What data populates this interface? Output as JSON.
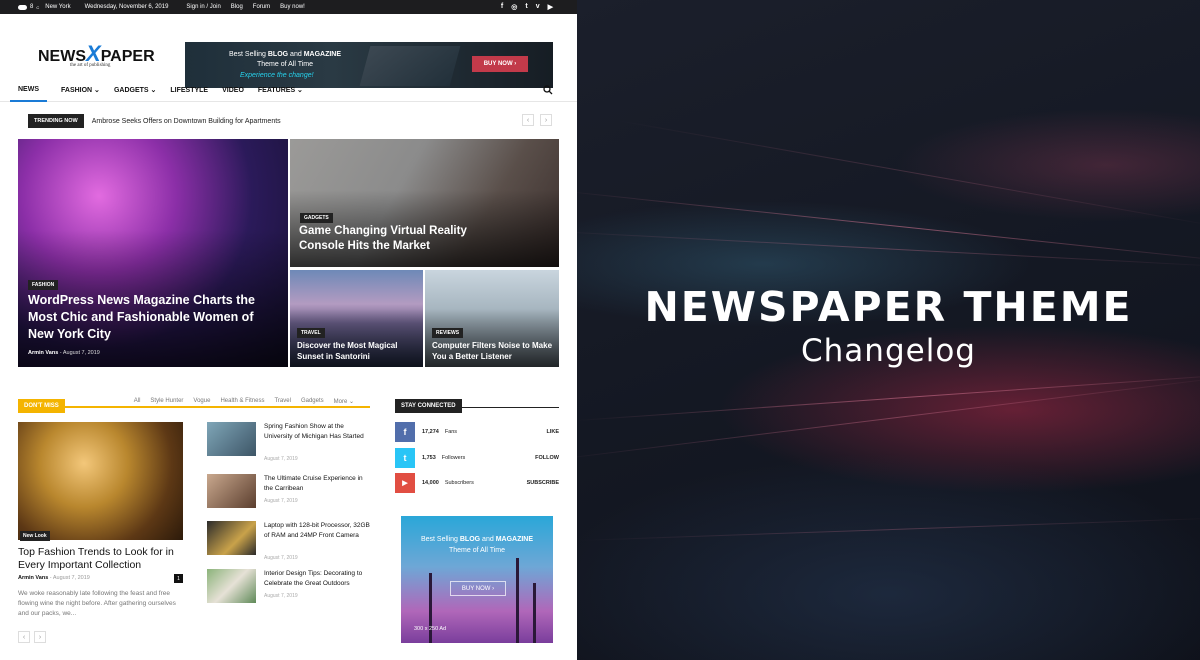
{
  "topbar": {
    "temp": "8",
    "temp_unit": "C",
    "city": "New York",
    "date": "Wednesday, November 6, 2019",
    "links": [
      "Sign in / Join",
      "Blog",
      "Forum",
      "Buy now!"
    ],
    "socials": [
      "f",
      "◎",
      "t",
      "v",
      "▶"
    ]
  },
  "logo": {
    "part1": "NEWS",
    "part2": "X",
    "part3": "PAPER",
    "tagline": "the art of publishing"
  },
  "header_ad": {
    "line1a": "Best Selling ",
    "line1b": "BLOG",
    "line1c": " and ",
    "line1d": "MAGAZINE",
    "line2": "Theme of All Time",
    "line3": "Experience the change!",
    "button": "BUY NOW ›"
  },
  "nav": {
    "items": [
      "NEWS",
      "FASHION ⌄",
      "GADGETS ⌄",
      "LIFESTYLE",
      "VIDEO",
      "FEATURES ⌄"
    ]
  },
  "trending": {
    "label": "TRENDING NOW",
    "headline": "Ambrose Seeks Offers on Downtown Building for Apartments",
    "prev": "‹",
    "next": "›"
  },
  "featured": [
    {
      "category": "FASHION",
      "title": "WordPress News Magazine Charts the Most Chic and Fashionable Women of New York City",
      "author": "Armin Vans",
      "date": "August 7, 2019"
    },
    {
      "category": "GADGETS",
      "title": "Game Changing Virtual Reality Console Hits the Market"
    },
    {
      "category": "TRAVEL",
      "title": "Discover the Most Magical Sunset in Santorini"
    },
    {
      "category": "REVIEWS",
      "title": "Computer Filters Noise to Make You a Better Listener"
    }
  ],
  "dont_miss": {
    "label": "DON'T MISS",
    "tabs": [
      "All",
      "Style Hunter",
      "Vogue",
      "Health & Fitness",
      "Travel",
      "Gadgets",
      "More ⌄"
    ],
    "big": {
      "category": "New Look",
      "title": "Top Fashion Trends to Look for in Every Important Collection",
      "author": "Armin Vans",
      "date": "August 7, 2019",
      "comments": "1",
      "excerpt": "We woke reasonably late following the feast and free flowing wine the night before. After gathering ourselves and our packs, we..."
    },
    "list": [
      {
        "title": "Spring Fashion Show at the University of Michigan Has Started",
        "date": "August 7, 2019"
      },
      {
        "title": "The Ultimate Cruise Experience in the Carribean",
        "date": "August 7, 2019"
      },
      {
        "title": "Laptop with 128-bit Processor, 32GB of RAM and 24MP Front Camera",
        "date": "August 7, 2019"
      },
      {
        "title": "Interior Design Tips: Decorating to Celebrate the Great Outdoors",
        "date": "August 7, 2019"
      }
    ],
    "pager_prev": "‹",
    "pager_next": "›"
  },
  "stay_connected": {
    "label": "STAY CONNECTED",
    "rows": [
      {
        "icon": "f",
        "count": "17,274",
        "kind": "Fans",
        "action": "LIKE",
        "color": "#516eab"
      },
      {
        "icon": "t",
        "count": "1,753",
        "kind": "Followers",
        "action": "FOLLOW",
        "color": "#29c5f6"
      },
      {
        "icon": "▶",
        "count": "14,000",
        "kind": "Subscribers",
        "action": "SUBSCRIBE",
        "color": "#e14e42"
      }
    ]
  },
  "side_ad": {
    "line1a": "Best Selling ",
    "line1b": "BLOG",
    "line1c": " and ",
    "line1d": "MAGAZINE",
    "line2": "Theme of All Time",
    "button": "BUY NOW ›",
    "size": "300 x 250 Ad"
  },
  "banner": {
    "title": "NEWSPAPER THEME",
    "subtitle": "Changelog"
  },
  "colors": {
    "accent": "#1a7bd6",
    "dont_miss": "#f4b400",
    "topbar": "#1d1d1f"
  }
}
